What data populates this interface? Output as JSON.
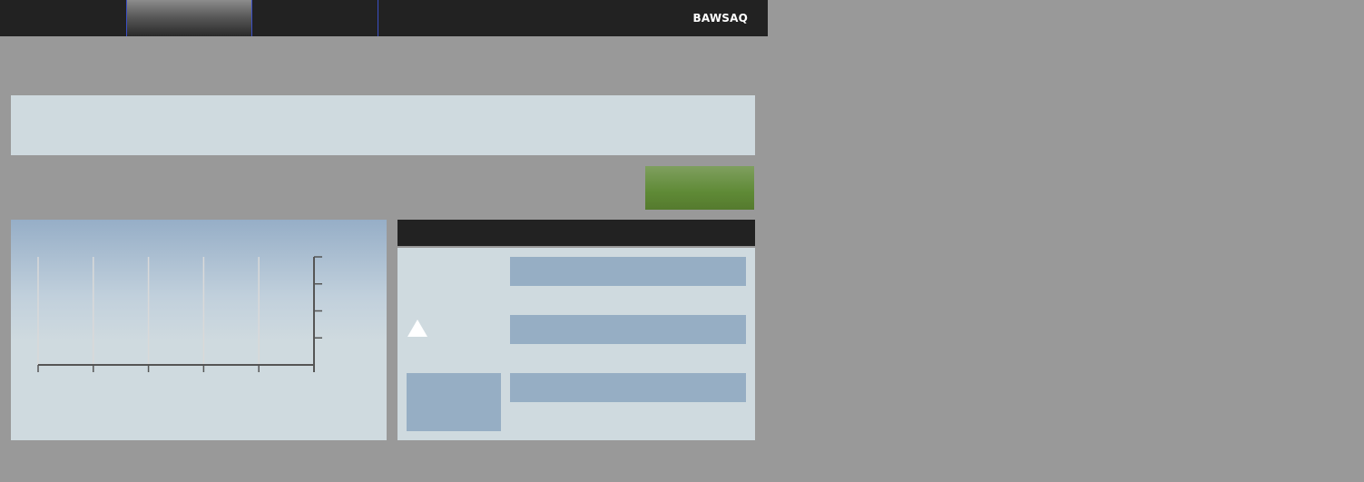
{
  "topbar": {
    "tabs": [
      {
        "label": ""
      },
      {
        "label": ""
      },
      {
        "label": ""
      }
    ],
    "logo": "BAWSAQ",
    "background_color": "#222222",
    "active_tab_border_color": "#3b4fc4"
  },
  "banner": {
    "text": ""
  },
  "action": {
    "label": "",
    "color": "#5f8a36"
  },
  "chart_data": {
    "type": "line",
    "title": "",
    "xlabel": "",
    "ylabel": "",
    "x_tick_count": 6,
    "y_tick_count": 5,
    "x_tick_labels": [],
    "y_tick_labels": [],
    "y_axis_position": "right",
    "grid": "vertical",
    "series": []
  },
  "detail": {
    "title": "",
    "fields": [
      {
        "value": ""
      },
      {
        "value": ""
      },
      {
        "value": ""
      }
    ],
    "trend_icon": "triangle-up-icon"
  },
  "colors": {
    "page_background": "#999999",
    "panel_background": "#cfdadf",
    "field_background": "#96aec4"
  }
}
